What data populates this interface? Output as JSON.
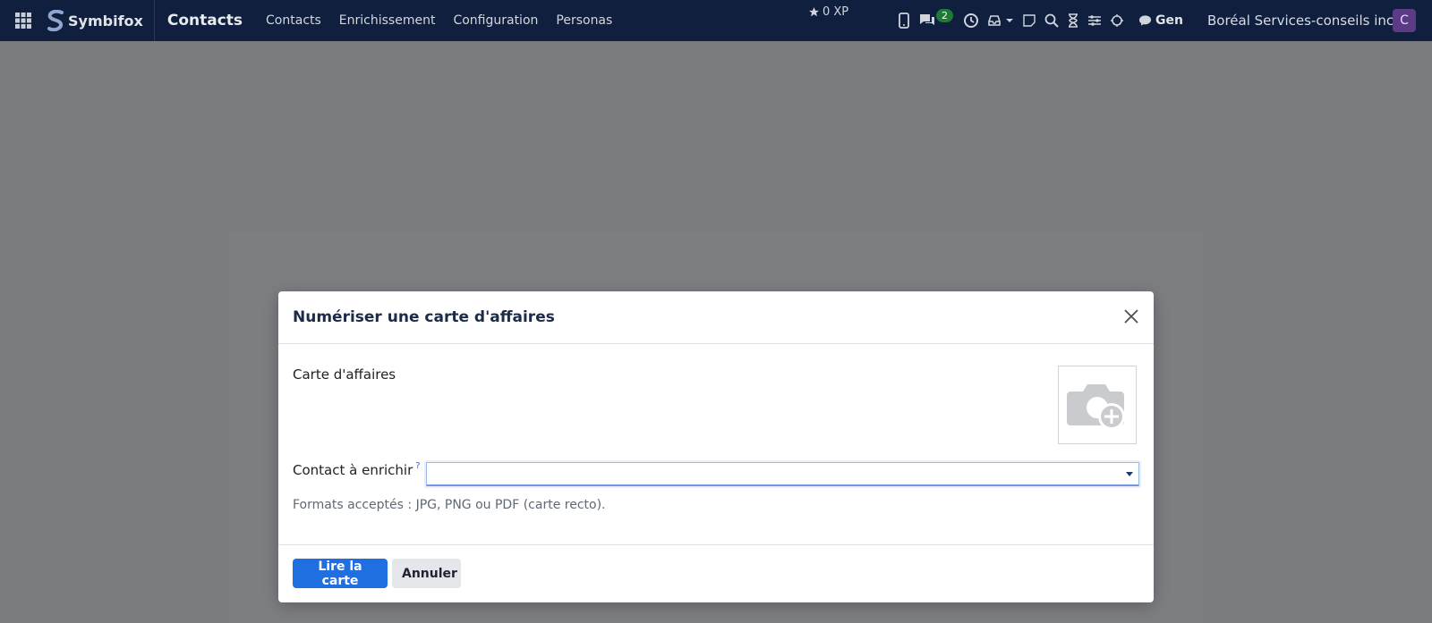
{
  "navbar": {
    "brand": "Symbifox",
    "app_title": "Contacts",
    "menu": [
      "Contacts",
      "Enrichissement",
      "Configuration",
      "Personas"
    ],
    "xp": "0 XP",
    "chat_count": "2",
    "gen_label": "Gen",
    "company": "Boréal Services-conseils inc.",
    "avatar_letter": "C"
  },
  "modal": {
    "title": "Numériser une carte d'affaires",
    "card_label": "Carte d'affaires",
    "contact_label": "Contact à enrichir",
    "help_mark": "?",
    "contact_value": "",
    "hint": "Formats acceptés : JPG, PNG ou PDF (carte recto).",
    "primary_button": "Lire la carte",
    "secondary_button": "Annuler"
  },
  "colors": {
    "navbar": "#0f1f3d",
    "primary": "#1f6fe0",
    "backdrop": "#7b7c80"
  }
}
